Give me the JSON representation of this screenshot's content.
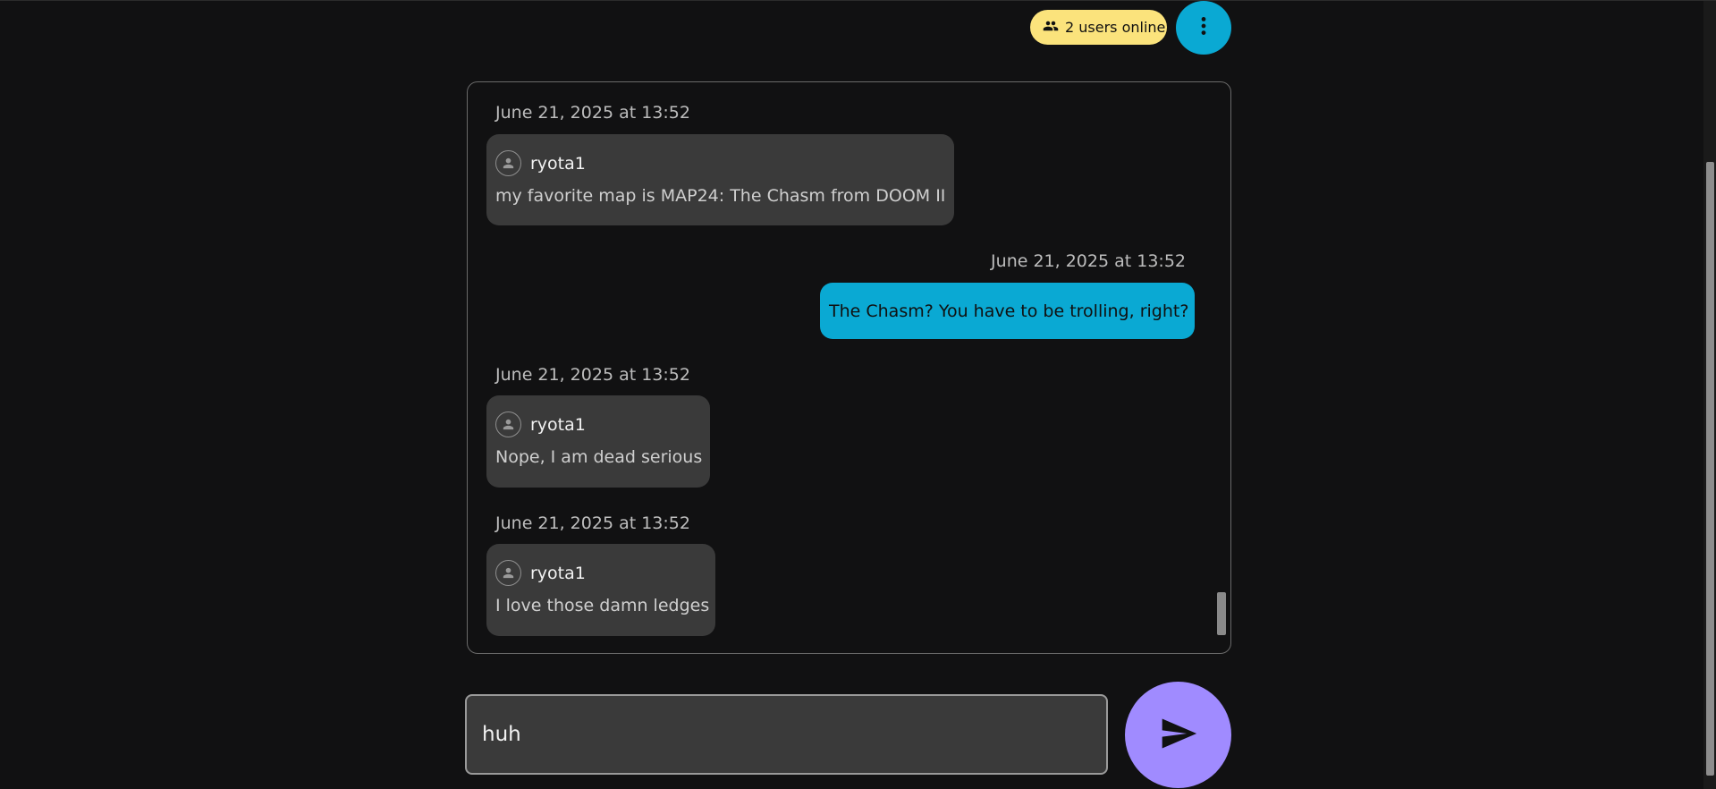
{
  "header": {
    "users_online_label": "2 users online",
    "users_icon": "users-icon",
    "menu_icon": "kebab-menu-icon"
  },
  "colors": {
    "background": "#111112",
    "users_badge": "#fbe37c",
    "menu_button": "#0aa9d3",
    "outgoing_bubble": "#0aa9d3",
    "incoming_bubble": "#3a3a3a",
    "send_button": "#a08bff"
  },
  "messages": [
    {
      "direction": "incoming",
      "timestamp": "June 21, 2025 at 13:52",
      "sender": "ryota1",
      "avatar_icon": "person-icon",
      "text": "my favorite map is MAP24: The Chasm from DOOM II"
    },
    {
      "direction": "outgoing",
      "timestamp": "June 21, 2025 at 13:52",
      "text": "The Chasm? You have to be trolling, right?"
    },
    {
      "direction": "incoming",
      "timestamp": "June 21, 2025 at 13:52",
      "sender": "ryota1",
      "avatar_icon": "person-icon",
      "text": "Nope, I am dead serious"
    },
    {
      "direction": "incoming",
      "timestamp": "June 21, 2025 at 13:52",
      "sender": "ryota1",
      "avatar_icon": "person-icon",
      "text": "I love those damn ledges"
    }
  ],
  "composer": {
    "value": "huh",
    "send_icon": "send-icon"
  }
}
